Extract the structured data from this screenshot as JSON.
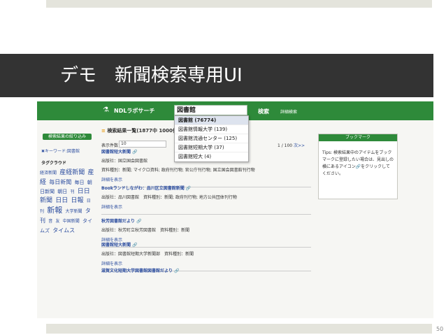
{
  "slide": {
    "title": "デモ　新聞検索専用UI",
    "page_number": "50"
  },
  "app": {
    "logo": "NDLラボサーチ",
    "search_value": "図書館",
    "search_button": "検索",
    "advanced_link": "詳細検索"
  },
  "sidebar": {
    "refine_button": "検索結果の絞り込み",
    "keyword_link": "✖キーワード:図書館",
    "tag_heading": "タグクラウド",
    "tags": [
      {
        "text": "経済新聞",
        "size": 6
      },
      {
        "text": "産経新聞",
        "size": 9
      },
      {
        "text": "産経",
        "size": 9
      },
      {
        "text": "毎日新聞",
        "size": 8
      },
      {
        "text": "毎日",
        "size": 7
      },
      {
        "text": "朝日新聞",
        "size": 7
      },
      {
        "text": "朝日",
        "size": 7
      },
      {
        "text": "刊",
        "size": 6
      },
      {
        "text": "日日新聞",
        "size": 9
      },
      {
        "text": "日日",
        "size": 9
      },
      {
        "text": "日報",
        "size": 9
      },
      {
        "text": "日刊",
        "size": 6
      },
      {
        "text": "新報",
        "size": 11
      },
      {
        "text": "大学新聞",
        "size": 6
      },
      {
        "text": "タ刊",
        "size": 8
      },
      {
        "text": "音",
        "size": 6
      },
      {
        "text": "友",
        "size": 6
      },
      {
        "text": "中国新聞",
        "size": 6
      },
      {
        "text": "タイムズ",
        "size": 7
      },
      {
        "text": "タイムス",
        "size": 8
      }
    ]
  },
  "results": {
    "heading_bullet": "≡",
    "heading": "検索結果一覧(1877中 1000件",
    "count_label": "表示件数",
    "count_value": "10",
    "pager_text": "1 / 100",
    "pager_next": "次>>",
    "items": [
      {
        "title": "図書館短大新聞",
        "lines": [
          "出版社：国立国会図書館",
          "資料種別：新聞; マイクロ資料; 政府刊行物; 官公庁刊行物; 国立国会図書館刊行物"
        ],
        "more": "詳細を表示"
      },
      {
        "title": "Bookランドしながわ：品川区立図書館新聞",
        "lines": [
          "出版社：品川図書館　資料種別：新聞; 政府刊行物; 地方公共団体刊行物"
        ],
        "more": "詳細を表示"
      },
      {
        "title": "秋芳図書館だより",
        "lines": [
          "出版社：秋芳町立秋芳図書館　資料種別：新聞"
        ],
        "more": "詳細を表示"
      },
      {
        "title": "図書館短大新聞",
        "lines": [
          "出版社：図書館短期大学新聞部　資料種別：新聞"
        ],
        "more": "詳細を表示"
      },
      {
        "title": "滋賀文化短期大学図書館図書館だより",
        "lines": [],
        "more": ""
      }
    ]
  },
  "dropdown": {
    "items": [
      "図書館 (76774)",
      "図書館情報大学 (139)",
      "図書館流通センター (125)",
      "図書館短期大学 (37)",
      "図書館短大 (4)"
    ]
  },
  "bookmark": {
    "heading": "ブックマーク",
    "text": "Tips: 検索結果中のアイテムをブックマークに登録したい場合は、見出しの横にあるアイコン🔗をクリックしてください。"
  },
  "colors": {
    "header_green": "#2e8a3a",
    "title_band": "#333333",
    "link_blue": "#2e4fa0"
  }
}
